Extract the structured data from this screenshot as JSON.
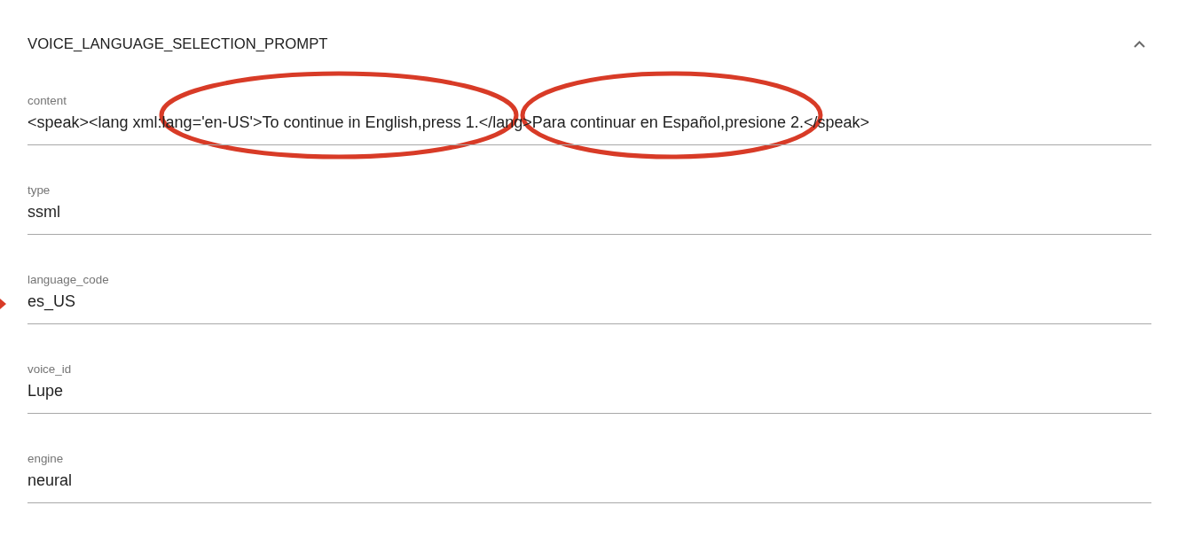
{
  "panel": {
    "title": "VOICE_LANGUAGE_SELECTION_PROMPT",
    "expanded": true
  },
  "fields": [
    {
      "label": "content",
      "value": "<speak><lang xml:lang='en-US'>To continue in English,press 1.</lang>Para continuar en Español,presione 2.</speak>"
    },
    {
      "label": "type",
      "value": "ssml"
    },
    {
      "label": "language_code",
      "value": "es_US"
    },
    {
      "label": "voice_id",
      "value": "Lupe"
    },
    {
      "label": "engine",
      "value": "neural"
    }
  ],
  "annotations": [
    {
      "kind": "ellipse"
    },
    {
      "kind": "ellipse"
    },
    {
      "kind": "arrow"
    }
  ]
}
